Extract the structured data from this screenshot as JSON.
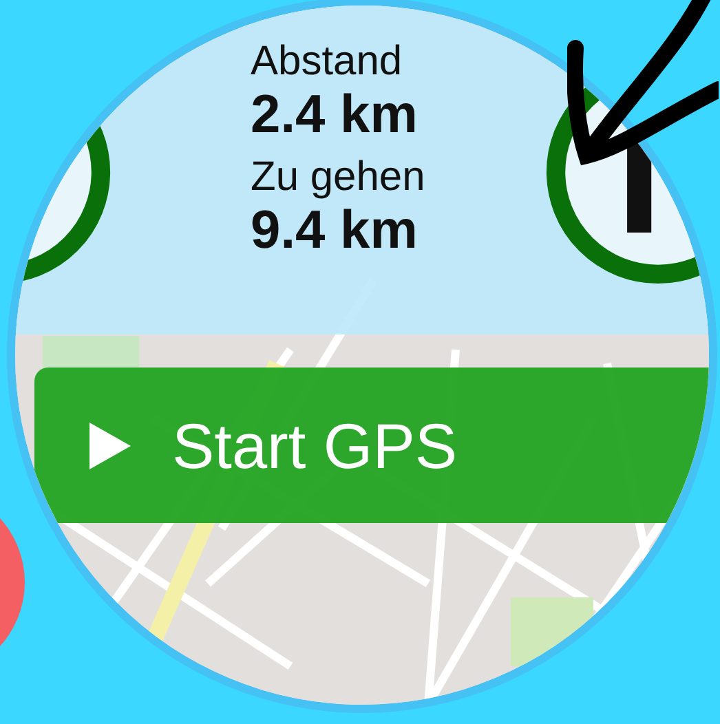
{
  "stats": [
    {
      "label": "Abstand",
      "value": "2.4 km"
    },
    {
      "label": "Zu gehen",
      "value": "9.4 km"
    }
  ],
  "start_button": {
    "label": "Start GPS"
  }
}
